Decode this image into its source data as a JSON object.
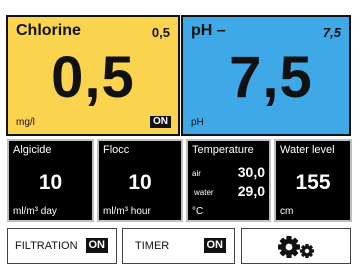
{
  "chlorine": {
    "title": "Chlorine",
    "setpoint": "0,5",
    "value": "0,5",
    "unit": "mg/l",
    "status": "ON"
  },
  "ph": {
    "title": "pH –",
    "setpoint": "7,5",
    "value": "7,5",
    "unit": "pH"
  },
  "algicide": {
    "label": "Algicide",
    "value": "10",
    "unit": "ml/m³ day"
  },
  "flocc": {
    "label": "Flocc",
    "value": "10",
    "unit": "ml/m³ hour"
  },
  "temperature": {
    "label": "Temperature",
    "air_label": "air",
    "air_value": "30,0",
    "water_label": "water",
    "water_value": "29,0",
    "unit": "°C"
  },
  "water_level": {
    "label": "Water level",
    "value": "155",
    "unit": "cm"
  },
  "buttons": {
    "filtration_label": "FILTRATION",
    "filtration_status": "ON",
    "timer_label": "TIMER",
    "timer_status": "ON",
    "settings_icon": "gears-icon"
  },
  "colors": {
    "chlorine_panel": "#fbd44f",
    "ph_panel": "#3fa9e8",
    "tile_background": "#000000",
    "tile_border": "#bfbfbf"
  }
}
